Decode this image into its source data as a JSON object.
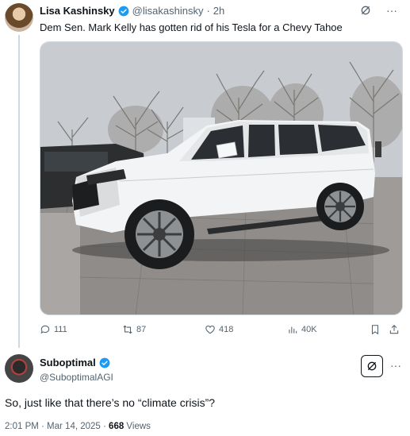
{
  "colors": {
    "accent": "#1d9bf0",
    "text": "#0f1419",
    "muted": "#536471",
    "border": "#cfd9de"
  },
  "original_tweet": {
    "author_name": "Lisa Kashinsky",
    "handle": "@lisakashinsky",
    "separator": "·",
    "time_ago": "2h",
    "text": "Dem Sen. Mark Kelly has gotten rid of his Tesla for a Chevy Tahoe",
    "image_alt": "white-suv-photo",
    "actions": {
      "replies": "111",
      "reposts": "87",
      "likes": "418",
      "views": "40K"
    }
  },
  "reply_tweet": {
    "author_name": "Suboptimal",
    "handle": "@SuboptimalAGI",
    "text": "So, just like that there’s no “climate crisis”?",
    "timestamp": "2:01 PM · Mar 14, 2025 · ",
    "views_count": "668",
    "views_label": " Views"
  },
  "icons": [
    "grok-icon",
    "more-icon",
    "reply-icon",
    "repost-icon",
    "like-icon",
    "views-icon",
    "bookmark-icon",
    "share-icon",
    "verified-badge-icon"
  ]
}
